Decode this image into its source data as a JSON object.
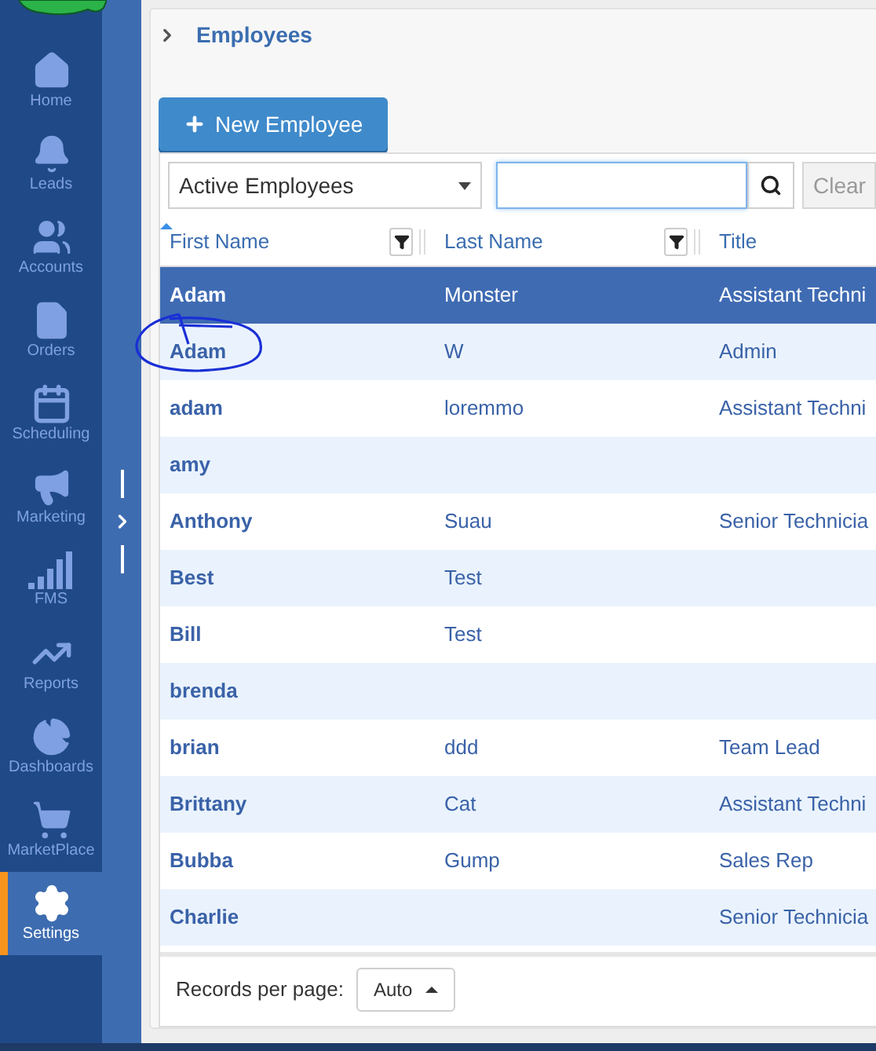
{
  "sidebar": {
    "items": [
      {
        "label": "Home",
        "selected": false
      },
      {
        "label": "Leads",
        "selected": false
      },
      {
        "label": "Accounts",
        "selected": false
      },
      {
        "label": "Orders",
        "selected": false
      },
      {
        "label": "Scheduling",
        "selected": false
      },
      {
        "label": "Marketing",
        "selected": false
      },
      {
        "label": "FMS",
        "selected": false
      },
      {
        "label": "Reports",
        "selected": false
      },
      {
        "label": "Dashboards",
        "selected": false
      },
      {
        "label": "MarketPlace",
        "selected": false
      },
      {
        "label": "Settings",
        "selected": true
      }
    ]
  },
  "breadcrumb": "Employees",
  "new_button": "New Employee",
  "filter": {
    "value": "Active Employees"
  },
  "clear_button": "Clear",
  "table": {
    "columns": [
      "First Name",
      "Last Name",
      "Title"
    ],
    "rows": [
      {
        "cells": [
          "Adam",
          "Monster",
          "Assistant Techni"
        ],
        "selected": true
      },
      {
        "cells": [
          "Adam",
          "W",
          "Admin"
        ],
        "selected": false
      },
      {
        "cells": [
          "adam",
          "loremmo",
          "Assistant Techni"
        ],
        "selected": false
      },
      {
        "cells": [
          "amy",
          "",
          ""
        ],
        "selected": false
      },
      {
        "cells": [
          "Anthony",
          "Suau",
          "Senior Technicia"
        ],
        "selected": false
      },
      {
        "cells": [
          "Best",
          "Test",
          ""
        ],
        "selected": false
      },
      {
        "cells": [
          "Bill",
          "Test",
          ""
        ],
        "selected": false
      },
      {
        "cells": [
          "brenda",
          "",
          ""
        ],
        "selected": false
      },
      {
        "cells": [
          "brian",
          "ddd",
          "Team Lead"
        ],
        "selected": false
      },
      {
        "cells": [
          "Brittany",
          "Cat",
          "Assistant Techni"
        ],
        "selected": false
      },
      {
        "cells": [
          "Bubba",
          "Gump",
          "Sales Rep"
        ],
        "selected": false
      },
      {
        "cells": [
          "Charlie",
          "",
          "Senior Technicia"
        ],
        "selected": false
      }
    ]
  },
  "pager": {
    "label": "Records per page:",
    "value": "Auto"
  }
}
